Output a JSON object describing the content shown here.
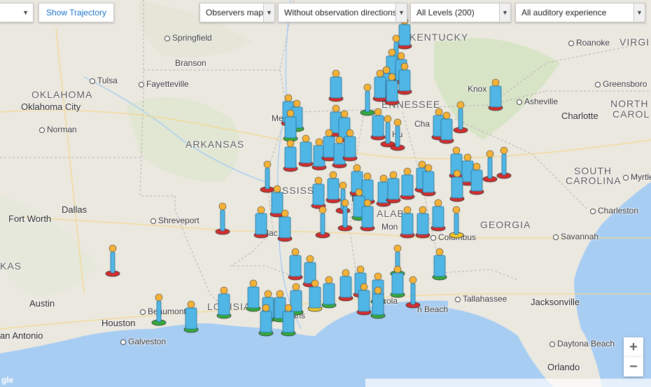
{
  "controls": {
    "show_trajectory": "Show Trajectory",
    "map_mode": "Observers map",
    "directions": "Without observation directions",
    "levels": "All Levels (200)",
    "auditory": "All auditory experience",
    "zoom_in": "+",
    "zoom_out": "−"
  },
  "places": [
    {
      "name": "Springfield",
      "kind": "city"
    },
    {
      "name": "Branson",
      "kind": "town"
    },
    {
      "name": "Tulsa",
      "kind": "city"
    },
    {
      "name": "Fayetteville",
      "kind": "city"
    },
    {
      "name": "OKLAHOMA",
      "kind": "state"
    },
    {
      "name": "Oklahoma City",
      "kind": "big"
    },
    {
      "name": "Norman",
      "kind": "city"
    },
    {
      "name": "ARKANSAS",
      "kind": "state"
    },
    {
      "name": "Dallas",
      "kind": "big"
    },
    {
      "name": "Fort Worth",
      "kind": "big"
    },
    {
      "name": "Shreveport",
      "kind": "city"
    },
    {
      "name": "KAS",
      "kind": "state"
    },
    {
      "name": "Austin",
      "kind": "big"
    },
    {
      "name": "Beaumont",
      "kind": "city"
    },
    {
      "name": "Houston",
      "kind": "big"
    },
    {
      "name": "Galveston",
      "kind": "city"
    },
    {
      "name": "an Antonio",
      "kind": "big"
    },
    {
      "name": "KENTUCKY",
      "kind": "state"
    },
    {
      "name": "Roanoke",
      "kind": "city"
    },
    {
      "name": "VIRGI",
      "kind": "state"
    },
    {
      "name": "Greensboro",
      "kind": "city"
    },
    {
      "name": "Knox",
      "kind": "town"
    },
    {
      "name": "Asheville",
      "kind": "city"
    },
    {
      "name": "Charlotte",
      "kind": "big"
    },
    {
      "name": "NORTH",
      "kind": "state"
    },
    {
      "name": "CAROL",
      "kind": "state"
    },
    {
      "name": "ENNESSEE",
      "kind": "state"
    },
    {
      "name": "Mem",
      "kind": "town"
    },
    {
      "name": "Cha",
      "kind": "town"
    },
    {
      "name": "Hu",
      "kind": "town"
    },
    {
      "name": "SOUTH",
      "kind": "state"
    },
    {
      "name": "CAROLINA",
      "kind": "state"
    },
    {
      "name": "Myrtle Be",
      "kind": "city"
    },
    {
      "name": "Charleston",
      "kind": "city"
    },
    {
      "name": "GEORGIA",
      "kind": "state"
    },
    {
      "name": "Savannah",
      "kind": "city"
    },
    {
      "name": "Columbus",
      "kind": "city"
    },
    {
      "name": "Mon",
      "kind": "town"
    },
    {
      "name": "Tallahassee",
      "kind": "city"
    },
    {
      "name": "Jacksonville",
      "kind": "big"
    },
    {
      "name": "Daytona Beach",
      "kind": "city"
    },
    {
      "name": "Orlando",
      "kind": "big"
    },
    {
      "name": "cola",
      "kind": "town"
    },
    {
      "name": "n Beach",
      "kind": "town"
    },
    {
      "name": "eans",
      "kind": "town"
    },
    {
      "name": "Jac",
      "kind": "town"
    },
    {
      "name": "LOUISIA",
      "kind": "state"
    },
    {
      "name": "ISSISS",
      "kind": "state"
    },
    {
      "name": "ALABA",
      "kind": "state"
    },
    {
      "name": "T",
      "kind": "town"
    }
  ],
  "markers": [
    {
      "lon": 578,
      "lat": 30,
      "color": "red",
      "full": true
    },
    {
      "lon": 566,
      "lat": 55,
      "color": "red",
      "full": false
    },
    {
      "lon": 560,
      "lat": 75,
      "color": "red",
      "full": true
    },
    {
      "lon": 573,
      "lat": 80,
      "color": "red",
      "full": true
    },
    {
      "lon": 552,
      "lat": 100,
      "color": "red",
      "full": true
    },
    {
      "lon": 578,
      "lat": 95,
      "color": "red",
      "full": true
    },
    {
      "lon": 543,
      "lat": 105,
      "color": "red",
      "full": true
    },
    {
      "lon": 560,
      "lat": 110,
      "color": "red",
      "full": true
    },
    {
      "lon": 480,
      "lat": 105,
      "color": "red",
      "full": true
    },
    {
      "lon": 525,
      "lat": 125,
      "color": "green",
      "full": false
    },
    {
      "lon": 708,
      "lat": 118,
      "color": "red",
      "full": true
    },
    {
      "lon": 412,
      "lat": 140,
      "color": "red",
      "full": true
    },
    {
      "lon": 424,
      "lat": 148,
      "color": "green",
      "full": true
    },
    {
      "lon": 415,
      "lat": 162,
      "color": "green",
      "full": true
    },
    {
      "lon": 480,
      "lat": 155,
      "color": "red",
      "full": true
    },
    {
      "lon": 492,
      "lat": 163,
      "color": "red",
      "full": true
    },
    {
      "lon": 540,
      "lat": 160,
      "color": "red",
      "full": true
    },
    {
      "lon": 554,
      "lat": 170,
      "color": "red",
      "full": false
    },
    {
      "lon": 568,
      "lat": 175,
      "color": "red",
      "full": false
    },
    {
      "lon": 627,
      "lat": 160,
      "color": "red",
      "full": true
    },
    {
      "lon": 638,
      "lat": 165,
      "color": "red",
      "full": true
    },
    {
      "lon": 658,
      "lat": 150,
      "color": "red",
      "full": false
    },
    {
      "lon": 415,
      "lat": 205,
      "color": "red",
      "full": true
    },
    {
      "lon": 437,
      "lat": 198,
      "color": "red",
      "full": true
    },
    {
      "lon": 456,
      "lat": 203,
      "color": "red",
      "full": true
    },
    {
      "lon": 470,
      "lat": 190,
      "color": "red",
      "full": true
    },
    {
      "lon": 485,
      "lat": 200,
      "color": "red",
      "full": true
    },
    {
      "lon": 500,
      "lat": 190,
      "color": "red",
      "full": true
    },
    {
      "lon": 382,
      "lat": 235,
      "color": "red",
      "full": false
    },
    {
      "lon": 455,
      "lat": 258,
      "color": "red",
      "full": true
    },
    {
      "lon": 476,
      "lat": 250,
      "color": "red",
      "full": true
    },
    {
      "lon": 490,
      "lat": 265,
      "color": "red",
      "full": false
    },
    {
      "lon": 510,
      "lat": 240,
      "color": "red",
      "full": true
    },
    {
      "lon": 525,
      "lat": 252,
      "color": "red",
      "full": true
    },
    {
      "lon": 548,
      "lat": 255,
      "color": "red",
      "full": true
    },
    {
      "lon": 562,
      "lat": 250,
      "color": "red",
      "full": true
    },
    {
      "lon": 582,
      "lat": 245,
      "color": "red",
      "full": true
    },
    {
      "lon": 603,
      "lat": 235,
      "color": "red",
      "full": true
    },
    {
      "lon": 612,
      "lat": 240,
      "color": "red",
      "full": true
    },
    {
      "lon": 652,
      "lat": 215,
      "color": "red",
      "full": true
    },
    {
      "lon": 668,
      "lat": 225,
      "color": "red",
      "full": true
    },
    {
      "lon": 681,
      "lat": 238,
      "color": "red",
      "full": true
    },
    {
      "lon": 700,
      "lat": 220,
      "color": "red",
      "full": false
    },
    {
      "lon": 720,
      "lat": 215,
      "color": "red",
      "full": false
    },
    {
      "lon": 653,
      "lat": 248,
      "color": "red",
      "full": true
    },
    {
      "lon": 396,
      "lat": 270,
      "color": "red",
      "full": true
    },
    {
      "lon": 513,
      "lat": 275,
      "color": "green",
      "full": true
    },
    {
      "lon": 525,
      "lat": 290,
      "color": "red",
      "full": true
    },
    {
      "lon": 373,
      "lat": 300,
      "color": "red",
      "full": true
    },
    {
      "lon": 407,
      "lat": 305,
      "color": "red",
      "full": true
    },
    {
      "lon": 318,
      "lat": 295,
      "color": "red",
      "full": false
    },
    {
      "lon": 461,
      "lat": 300,
      "color": "red",
      "full": false
    },
    {
      "lon": 493,
      "lat": 290,
      "color": "red",
      "full": false
    },
    {
      "lon": 582,
      "lat": 300,
      "color": "red",
      "full": true
    },
    {
      "lon": 604,
      "lat": 300,
      "color": "red",
      "full": true
    },
    {
      "lon": 626,
      "lat": 290,
      "color": "red",
      "full": true
    },
    {
      "lon": 652,
      "lat": 300,
      "color": "yellow",
      "full": false
    },
    {
      "lon": 161,
      "lat": 355,
      "color": "red",
      "full": false
    },
    {
      "lon": 568,
      "lat": 355,
      "color": "green",
      "full": false
    },
    {
      "lon": 628,
      "lat": 360,
      "color": "green",
      "full": true
    },
    {
      "lon": 422,
      "lat": 360,
      "color": "red",
      "full": true
    },
    {
      "lon": 443,
      "lat": 370,
      "color": "red",
      "full": true
    },
    {
      "lon": 494,
      "lat": 390,
      "color": "red",
      "full": true
    },
    {
      "lon": 515,
      "lat": 385,
      "color": "red",
      "full": true
    },
    {
      "lon": 540,
      "lat": 395,
      "color": "green",
      "full": true
    },
    {
      "lon": 568,
      "lat": 385,
      "color": "green",
      "full": true
    },
    {
      "lon": 320,
      "lat": 415,
      "color": "green",
      "full": true
    },
    {
      "lon": 362,
      "lat": 405,
      "color": "green",
      "full": true
    },
    {
      "lon": 383,
      "lat": 420,
      "color": "green",
      "full": true
    },
    {
      "lon": 400,
      "lat": 420,
      "color": "green",
      "full": true
    },
    {
      "lon": 423,
      "lat": 410,
      "color": "green",
      "full": true
    },
    {
      "lon": 450,
      "lat": 405,
      "color": "yellow",
      "full": true
    },
    {
      "lon": 470,
      "lat": 400,
      "color": "green",
      "full": true
    },
    {
      "lon": 520,
      "lat": 410,
      "color": "red",
      "full": true
    },
    {
      "lon": 540,
      "lat": 415,
      "color": "green",
      "full": true
    },
    {
      "lon": 590,
      "lat": 400,
      "color": "red",
      "full": false
    },
    {
      "lon": 227,
      "lat": 425,
      "color": "green",
      "full": false
    },
    {
      "lon": 273,
      "lat": 435,
      "color": "green",
      "full": true
    },
    {
      "lon": 380,
      "lat": 440,
      "color": "green",
      "full": true
    },
    {
      "lon": 412,
      "lat": 440,
      "color": "green",
      "full": true
    }
  ]
}
